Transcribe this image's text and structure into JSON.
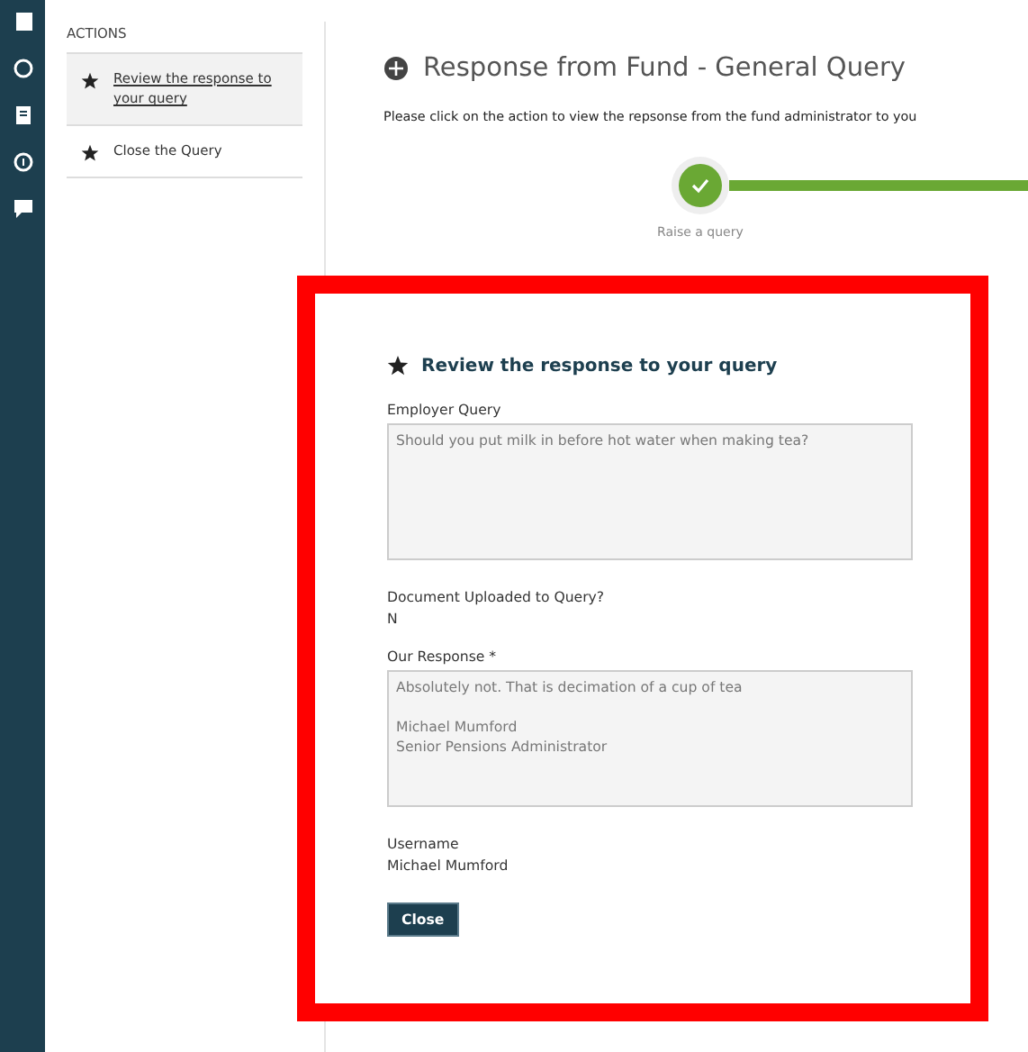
{
  "sidebar": {
    "heading": "ACTIONS",
    "items": [
      {
        "label": "Review the response to your query",
        "selected": true
      },
      {
        "label": "Close the Query",
        "selected": false
      }
    ]
  },
  "page": {
    "title": "Response from Fund - General Query",
    "instruction": "Please click on the action to view the repsonse from the fund administrator to you",
    "steps": [
      {
        "label": "Raise a query",
        "done": true
      }
    ]
  },
  "form": {
    "title": "Review the response to your query",
    "fields": [
      {
        "kind": "textarea",
        "label": "Employer Query",
        "value": "Should you put milk in before hot water when making tea?"
      },
      {
        "kind": "text",
        "label": "Document Uploaded to Query?",
        "value": "N"
      },
      {
        "kind": "textarea",
        "label": "Our Response *",
        "value": "Absolutely not. That is decimation of a cup of tea\n\nMichael Mumford\nSenior Pensions Administrator"
      },
      {
        "kind": "text",
        "label": "Username",
        "value": "Michael Mumford"
      }
    ],
    "button": "Close"
  }
}
